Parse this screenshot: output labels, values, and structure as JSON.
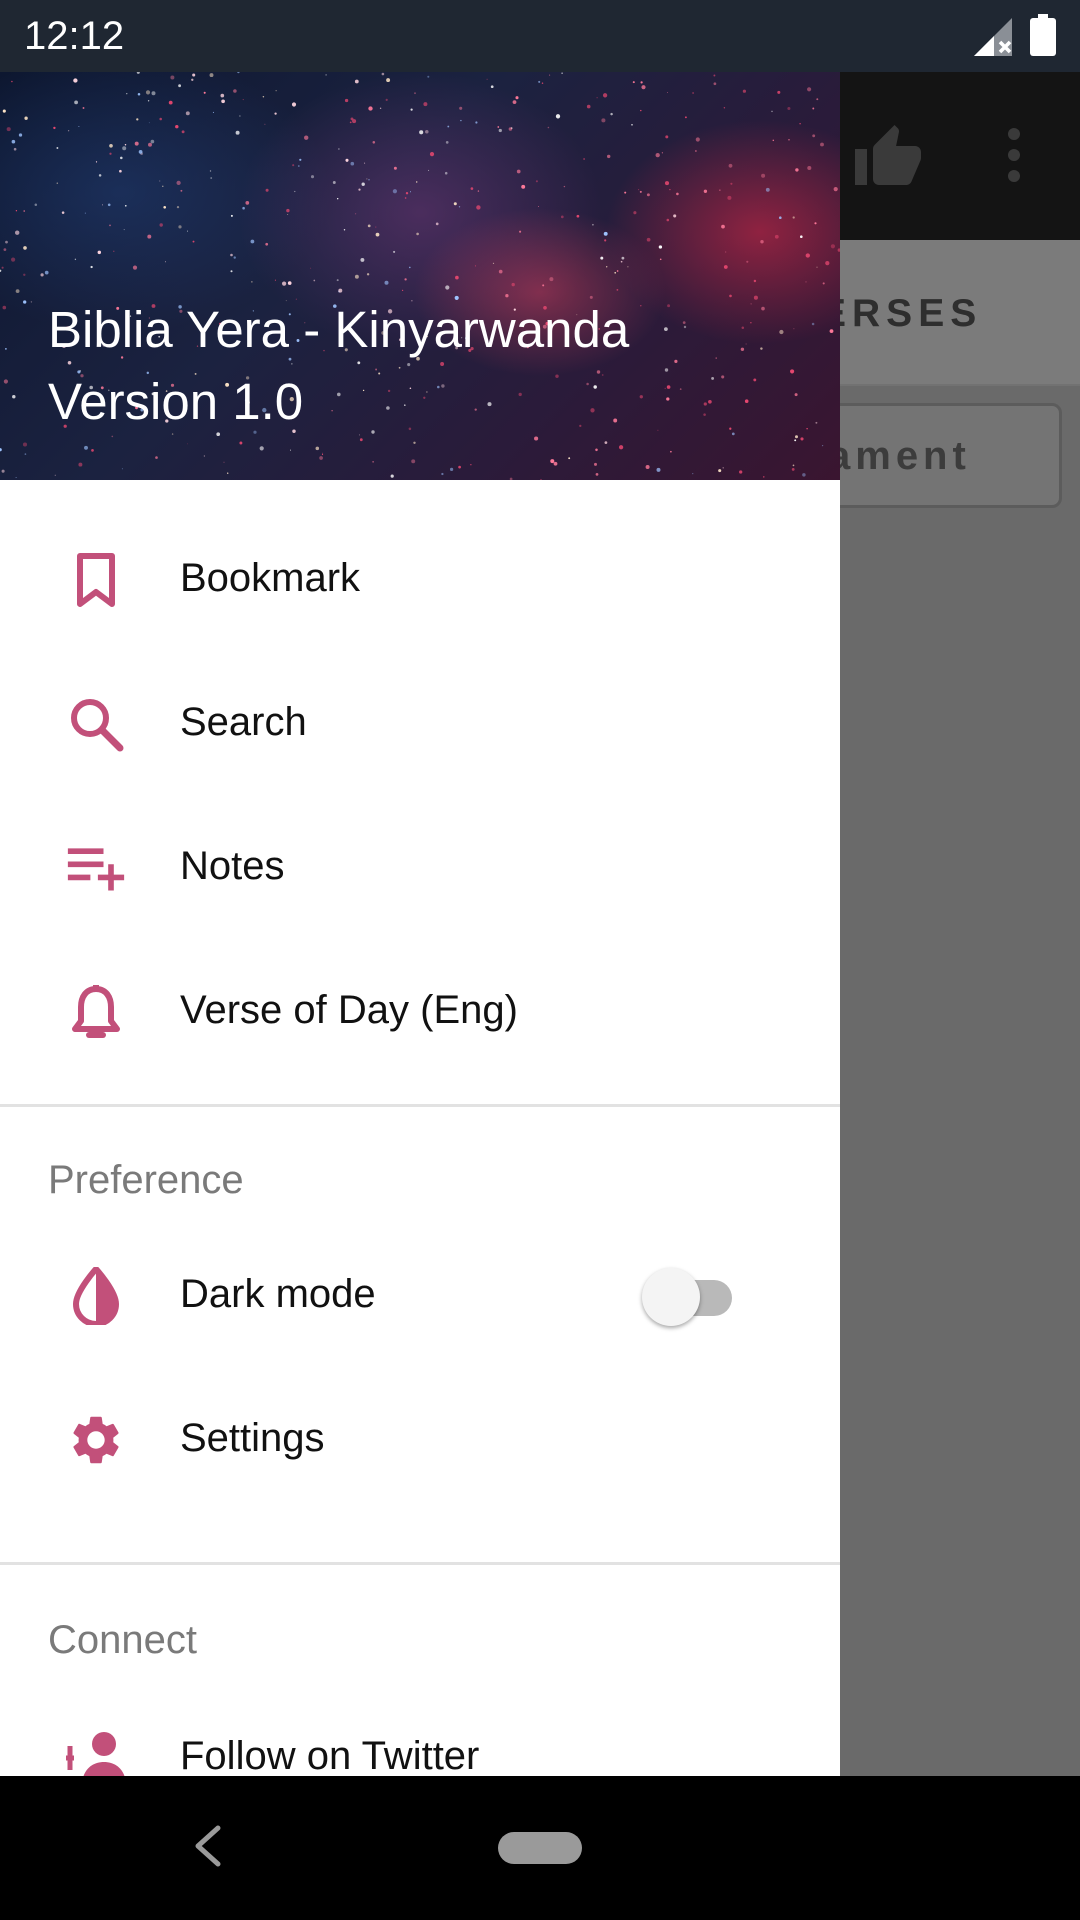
{
  "status_bar": {
    "time": "12:12"
  },
  "background_app": {
    "tab_label": "ERSES",
    "chip_label": "ament"
  },
  "drawer": {
    "header": {
      "app_name": "Biblia Yera - Kinyarwanda",
      "version": "Version 1.0"
    },
    "items": [
      {
        "label": "Bookmark",
        "icon": "bookmark-icon"
      },
      {
        "label": "Search",
        "icon": "search-icon"
      },
      {
        "label": "Notes",
        "icon": "playlist-add-icon"
      },
      {
        "label": "Verse of Day (Eng)",
        "icon": "bell-icon"
      }
    ],
    "preference": {
      "title": "Preference",
      "items": [
        {
          "label": "Dark mode",
          "icon": "contrast-icon",
          "toggle_on": false
        },
        {
          "label": "Settings",
          "icon": "gear-icon"
        }
      ]
    },
    "connect": {
      "title": "Connect",
      "items": [
        {
          "label": "Follow on Twitter",
          "icon": "people-icon"
        }
      ]
    }
  },
  "colors": {
    "accent": "#c2507a",
    "status_bar": "#1f2732",
    "drawer_bg": "#ffffff",
    "scrim": "#6a6a6a"
  }
}
